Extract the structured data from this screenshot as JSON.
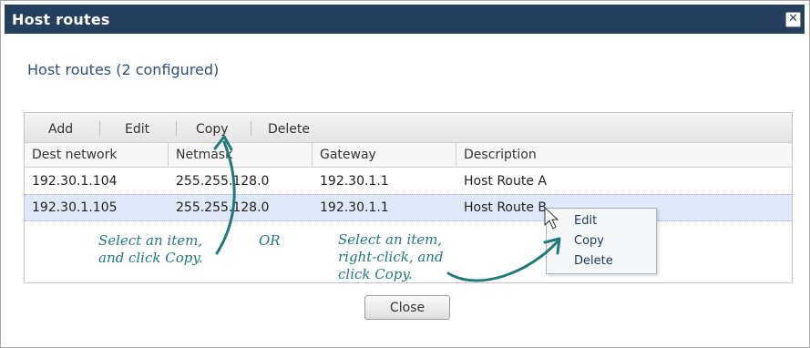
{
  "dialog": {
    "title": "Host routes",
    "heading": "Host routes (2 configured)"
  },
  "toolbar": {
    "add": "Add",
    "edit": "Edit",
    "copy": "Copy",
    "delete": "Delete"
  },
  "table": {
    "columns": [
      "Dest network",
      "Netmask",
      "Gateway",
      "Description"
    ],
    "rows": [
      [
        "192.30.1.104",
        "255.255.128.0",
        "192.30.1.1",
        "Host Route A"
      ],
      [
        "192.30.1.105",
        "255.255.128.0",
        "192.30.1.1",
        "Host Route B"
      ]
    ]
  },
  "context_menu": {
    "items": [
      "Edit",
      "Copy",
      "Delete"
    ]
  },
  "footer": {
    "close": "Close"
  },
  "annotations": {
    "left": [
      "Select an item,",
      "and click Copy."
    ],
    "or": "OR",
    "right": [
      "Select an item,",
      "right-click, and",
      "click Copy."
    ]
  },
  "colors": {
    "titlebar": "#25405f",
    "heading": "#2c4f7c",
    "annotation": "#1f7a78",
    "selected_row": "#dfe8f6"
  }
}
